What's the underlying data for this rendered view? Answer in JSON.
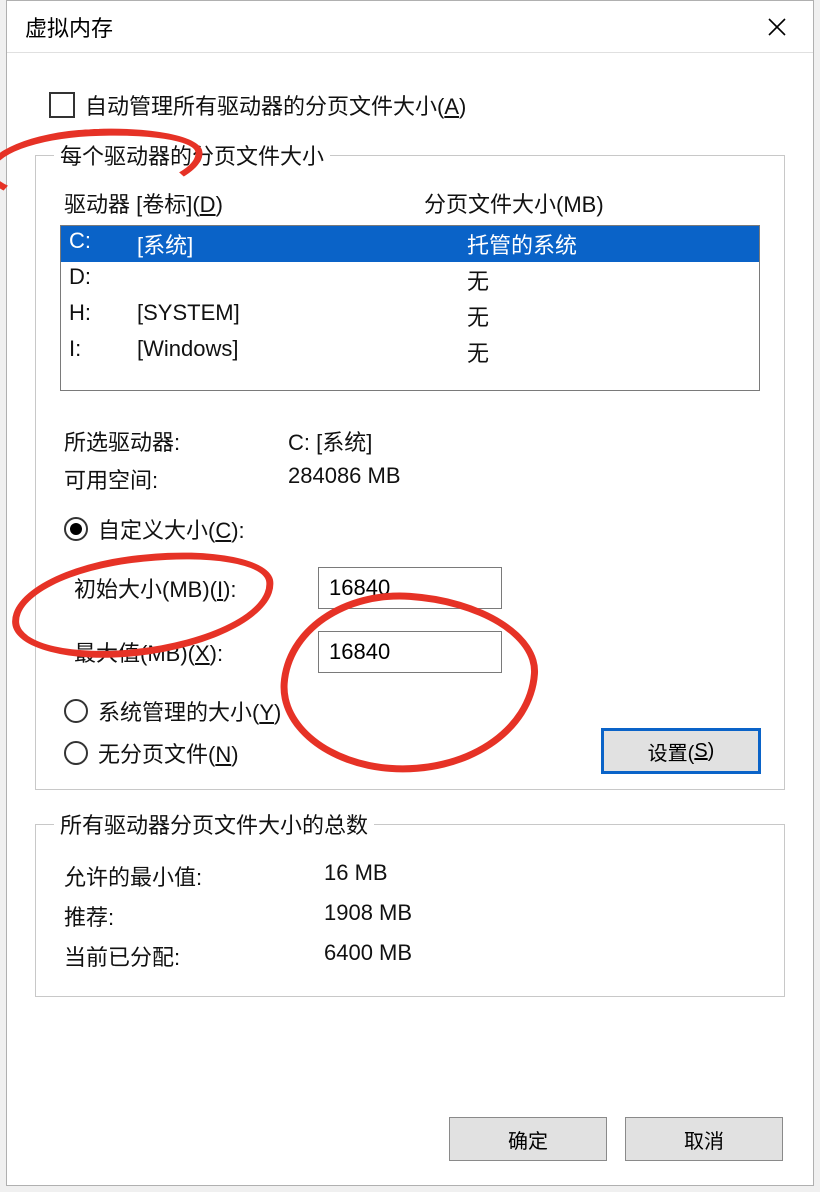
{
  "dialog": {
    "title": "虚拟内存"
  },
  "autoManage": {
    "label": "自动管理所有驱动器的分页文件大小(",
    "hotkey": "A",
    "tail": ")"
  },
  "group1": {
    "legend": "每个驱动器的分页文件大小",
    "header": {
      "drive": "驱动器 [卷标](",
      "drive_hotkey": "D",
      "drive_tail": ")",
      "pagingSize": "分页文件大小(MB)"
    },
    "drives": [
      {
        "letter": "C:",
        "label": "[系统]",
        "size": "托管的系统",
        "selected": true
      },
      {
        "letter": "D:",
        "label": "",
        "size": "无",
        "selected": false
      },
      {
        "letter": "H:",
        "label": "[SYSTEM]",
        "size": "无",
        "selected": false
      },
      {
        "letter": "I:",
        "label": "[Windows]",
        "size": "无",
        "selected": false
      }
    ],
    "selected": {
      "label1": "所选驱动器:",
      "value1": "C:  [系统]",
      "label2": "可用空间:",
      "value2": "284086 MB"
    },
    "radios": {
      "custom": {
        "label": "自定义大小(",
        "hotkey": "C",
        "tail": "):",
        "checked": true
      },
      "system": {
        "label": "系统管理的大小(",
        "hotkey": "Y",
        "tail": ")",
        "checked": false
      },
      "none": {
        "label": "无分页文件(",
        "hotkey": "N",
        "tail": ")",
        "checked": false
      }
    },
    "initial": {
      "label": "初始大小(MB)(",
      "hotkey": "I",
      "tail": "):",
      "value": "16840"
    },
    "maximum": {
      "label": "最大值(MB)(",
      "hotkey": "X",
      "tail": "):",
      "value": "16840"
    },
    "setBtn": {
      "label": "设置(",
      "hotkey": "S",
      "tail": ")"
    }
  },
  "group2": {
    "legend": "所有驱动器分页文件大小的总数",
    "rows": [
      {
        "label": "允许的最小值:",
        "value": "16 MB"
      },
      {
        "label": "推荐:",
        "value": "1908 MB"
      },
      {
        "label": "当前已分配:",
        "value": "6400 MB"
      }
    ]
  },
  "footer": {
    "ok": "确定",
    "cancel": "取消"
  }
}
